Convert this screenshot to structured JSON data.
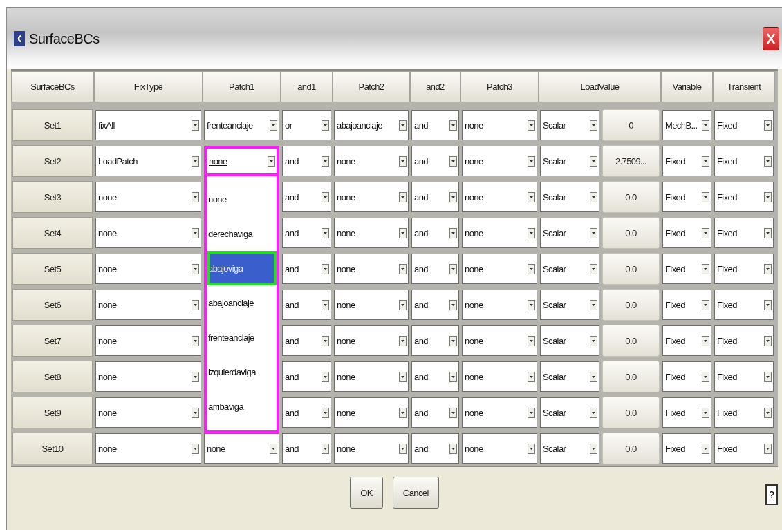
{
  "window": {
    "title": "SurfaceBCs"
  },
  "columns": [
    "SurfaceBCs",
    "FixType",
    "Patch1",
    "and1",
    "Patch2",
    "and2",
    "Patch3",
    "LoadValue",
    "Variable",
    "Transient"
  ],
  "rows": [
    {
      "label": "Set1",
      "fix_type": "fixAll",
      "patch1": "frenteanclaje",
      "and1": "or",
      "patch2": "abajoanclaje",
      "and2": "and",
      "patch3": "none",
      "load_type": "Scalar",
      "load_value": "0",
      "variable": "MechB...",
      "transient": "Fixed"
    },
    {
      "label": "Set2",
      "fix_type": "LoadPatch",
      "patch1": "none",
      "patch1_open": true,
      "patch1_options": [
        {
          "label": "none",
          "selected": false
        },
        {
          "label": "derechaviga",
          "selected": false
        },
        {
          "label": "abajoviga",
          "selected": true
        },
        {
          "label": "abajoanclaje",
          "selected": false
        },
        {
          "label": "frenteanclaje",
          "selected": false
        },
        {
          "label": "izquierdaviga",
          "selected": false
        },
        {
          "label": "arribaviga",
          "selected": false
        }
      ],
      "and1": "and",
      "patch2": "none",
      "and2": "and",
      "patch3": "none",
      "load_type": "Scalar",
      "load_value": "2.7509...",
      "variable": "Fixed",
      "transient": "Fixed"
    },
    {
      "label": "Set3",
      "fix_type": "none",
      "and1": "and",
      "patch2": "none",
      "and2": "and",
      "patch3": "none",
      "load_type": "Scalar",
      "load_value": "0.0",
      "variable": "Fixed",
      "transient": "Fixed"
    },
    {
      "label": "Set4",
      "fix_type": "none",
      "and1": "and",
      "patch2": "none",
      "and2": "and",
      "patch3": "none",
      "load_type": "Scalar",
      "load_value": "0.0",
      "variable": "Fixed",
      "transient": "Fixed"
    },
    {
      "label": "Set5",
      "fix_type": "none",
      "and1": "and",
      "patch2": "none",
      "and2": "and",
      "patch3": "none",
      "load_type": "Scalar",
      "load_value": "0.0",
      "variable": "Fixed",
      "transient": "Fixed"
    },
    {
      "label": "Set6",
      "fix_type": "none",
      "and1": "and",
      "patch2": "none",
      "and2": "and",
      "patch3": "none",
      "load_type": "Scalar",
      "load_value": "0.0",
      "variable": "Fixed",
      "transient": "Fixed"
    },
    {
      "label": "Set7",
      "fix_type": "none",
      "and1": "and",
      "patch2": "none",
      "and2": "and",
      "patch3": "none",
      "load_type": "Scalar",
      "load_value": "0.0",
      "variable": "Fixed",
      "transient": "Fixed"
    },
    {
      "label": "Set8",
      "fix_type": "none",
      "and1": "and",
      "patch2": "none",
      "and2": "and",
      "patch3": "none",
      "load_type": "Scalar",
      "load_value": "0.0",
      "variable": "Fixed",
      "transient": "Fixed"
    },
    {
      "label": "Set9",
      "fix_type": "none",
      "and1": "and",
      "patch2": "none",
      "and2": "and",
      "patch3": "none",
      "load_type": "Scalar",
      "load_value": "0.0",
      "variable": "Fixed",
      "transient": "Fixed"
    },
    {
      "label": "Set10",
      "fix_type": "none",
      "patch1": "none",
      "and1": "and",
      "patch2": "none",
      "and2": "and",
      "patch3": "none",
      "load_type": "Scalar",
      "load_value": "0.0",
      "variable": "Fixed",
      "transient": "Fixed"
    }
  ],
  "buttons": [
    "OK",
    "Cancel"
  ],
  "help_button": "?"
}
